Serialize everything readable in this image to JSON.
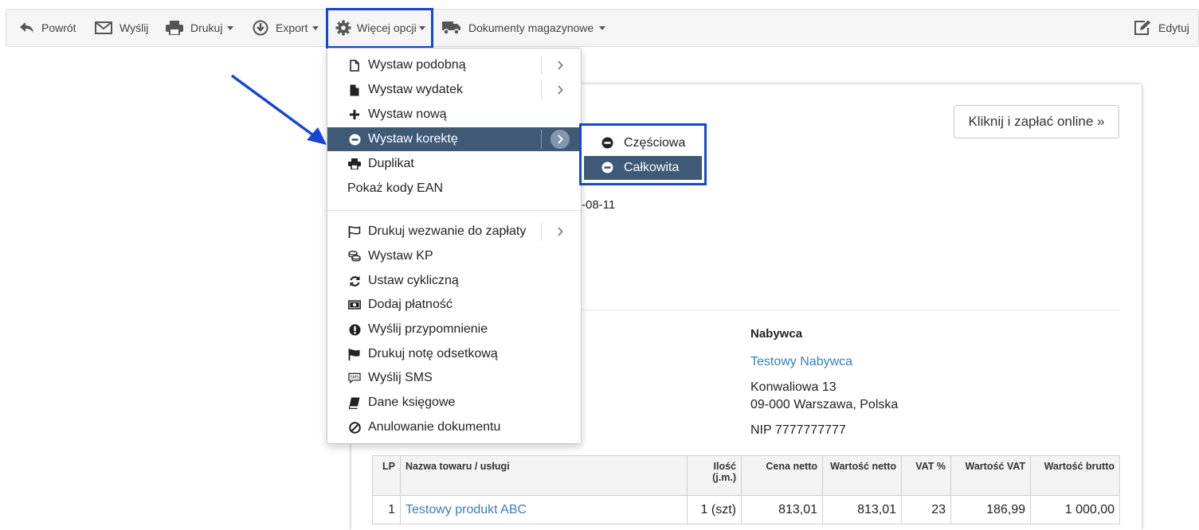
{
  "toolbar": {
    "back": "Powrót",
    "send": "Wyślij",
    "print": "Drukuj",
    "export": "Export",
    "more": "Więcej opcji",
    "warehouse": "Dokumenty magazynowe",
    "edit": "Edytuj"
  },
  "menu": {
    "items": [
      {
        "label": "Wystaw podobną",
        "icon": "file-outline-icon",
        "submenu": true
      },
      {
        "label": "Wystaw wydatek",
        "icon": "file-solid-icon",
        "submenu": true
      },
      {
        "label": "Wystaw nową",
        "icon": "plus-icon",
        "submenu": false
      },
      {
        "label": "Wystaw korektę",
        "icon": "minus-circle-icon",
        "submenu": true,
        "active": true
      },
      {
        "label": "Duplikat",
        "icon": "print-icon",
        "submenu": false
      },
      {
        "label": "Pokaż kody EAN",
        "icon": "",
        "submenu": false
      },
      {
        "label": "Drukuj wezwanie do zapłaty",
        "icon": "flag-outline-icon",
        "submenu": true
      },
      {
        "label": "Wystaw KP",
        "icon": "coins-icon",
        "submenu": false
      },
      {
        "label": "Ustaw cykliczną",
        "icon": "sync-icon",
        "submenu": false
      },
      {
        "label": "Dodaj płatność",
        "icon": "money-bill-icon",
        "submenu": false
      },
      {
        "label": "Wyślij przypomnienie",
        "icon": "exclamation-circle-icon",
        "submenu": false
      },
      {
        "label": "Drukuj notę odsetkową",
        "icon": "flag-solid-icon",
        "submenu": false
      },
      {
        "label": "Wyślij SMS",
        "icon": "sms-icon",
        "submenu": false
      },
      {
        "label": "Dane księgowe",
        "icon": "book-icon",
        "submenu": false
      },
      {
        "label": "Anulowanie dokumentu",
        "icon": "ban-icon",
        "submenu": false
      }
    ]
  },
  "submenu": {
    "items": [
      {
        "label": "Częściowa",
        "active": false
      },
      {
        "label": "Całkowita",
        "active": true
      }
    ]
  },
  "document": {
    "pay_button": "Kliknij i zapłać online »",
    "date_fragment": "-08-11",
    "buyer": {
      "heading": "Nabywca",
      "name": "Testowy Nabywca",
      "street": "Konwaliowa 13",
      "city": "09-000 Warszawa, Polska",
      "nip": "NIP 7777777777"
    },
    "table": {
      "headers": [
        "LP",
        "Nazwa towaru / usługi",
        "Ilość (j.m.)",
        "Cena netto",
        "Wartość netto",
        "VAT %",
        "Wartość VAT",
        "Wartość brutto"
      ],
      "rows": [
        [
          "1",
          "Testowy produkt ABC",
          "1 (szt)",
          "813,01",
          "813,01",
          "23",
          "186,99",
          "1 000,00"
        ]
      ]
    }
  },
  "colors": {
    "highlight_border": "#1746d6",
    "active_item": "#3f5a77",
    "link": "#3a7ebd"
  }
}
